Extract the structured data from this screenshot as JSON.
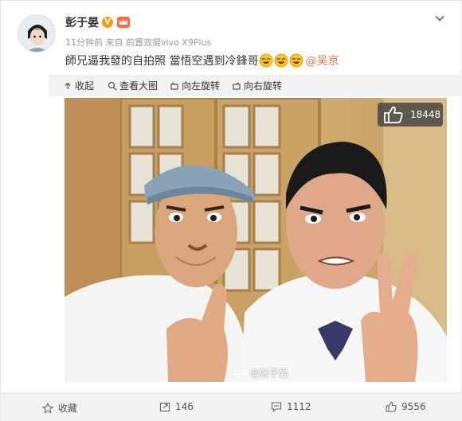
{
  "post": {
    "user_name": "彭于晏",
    "verified_badge": "V",
    "meta": "11分钟前 来自 前置双摄vivo X9Plus",
    "text": "師兄逼我發的自拍照 當悟空遇到冷鋒哥",
    "mention": "@吴京"
  },
  "toolbar": {
    "collapse": "收起",
    "view_large": "查看大图",
    "rotate_left": "向左旋转",
    "rotate_right": "向右旋转"
  },
  "photo": {
    "like_count": "18448",
    "watermark": "@彭于晏"
  },
  "footer": {
    "favorite": "收藏",
    "repost": "146",
    "comment": "1112",
    "like": "9556"
  },
  "colors": {
    "accent": "#eb7350",
    "toolbar_bg": "#f2f2f5",
    "verified": "#f79a1c"
  },
  "icons": [
    "chevron-down-icon",
    "undo-arrow-icon",
    "magnifier-icon",
    "rotate-left-icon",
    "rotate-right-icon",
    "thumbs-up-icon",
    "star-icon",
    "repost-icon",
    "comment-icon",
    "weibo-logo-icon"
  ]
}
